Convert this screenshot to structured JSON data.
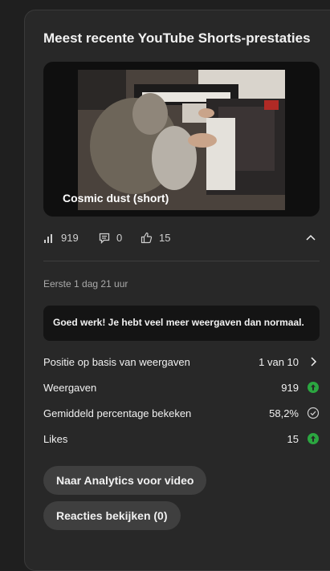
{
  "card": {
    "title": "Meest recente YouTube Shorts-prestaties",
    "video": {
      "caption": "Cosmic dust (short)"
    },
    "stats": {
      "views": "919",
      "comments": "0",
      "likes": "15"
    },
    "since": "Eerste 1 dag 21 uur",
    "banner": "Goed werk! Je hebt veel meer weergaven dan normaal.",
    "metrics": [
      {
        "label": "Positie op basis van weergaven",
        "value": "1 van 10",
        "icon": "chevron-right-icon"
      },
      {
        "label": "Weergaven",
        "value": "919",
        "icon": "arrow-up-circle-icon"
      },
      {
        "label": "Gemiddeld percentage bekeken",
        "value": "58,2%",
        "icon": "check-circle-icon"
      },
      {
        "label": "Likes",
        "value": "15",
        "icon": "arrow-up-circle-icon"
      }
    ],
    "buttons": {
      "analytics": "Naar Analytics voor video",
      "comments": "Reacties bekijken (0)"
    }
  },
  "colors": {
    "background": "#1f1f1f",
    "card": "#282828",
    "banner": "#141414",
    "positive": "#2ba640",
    "button": "#3f3f3f"
  }
}
